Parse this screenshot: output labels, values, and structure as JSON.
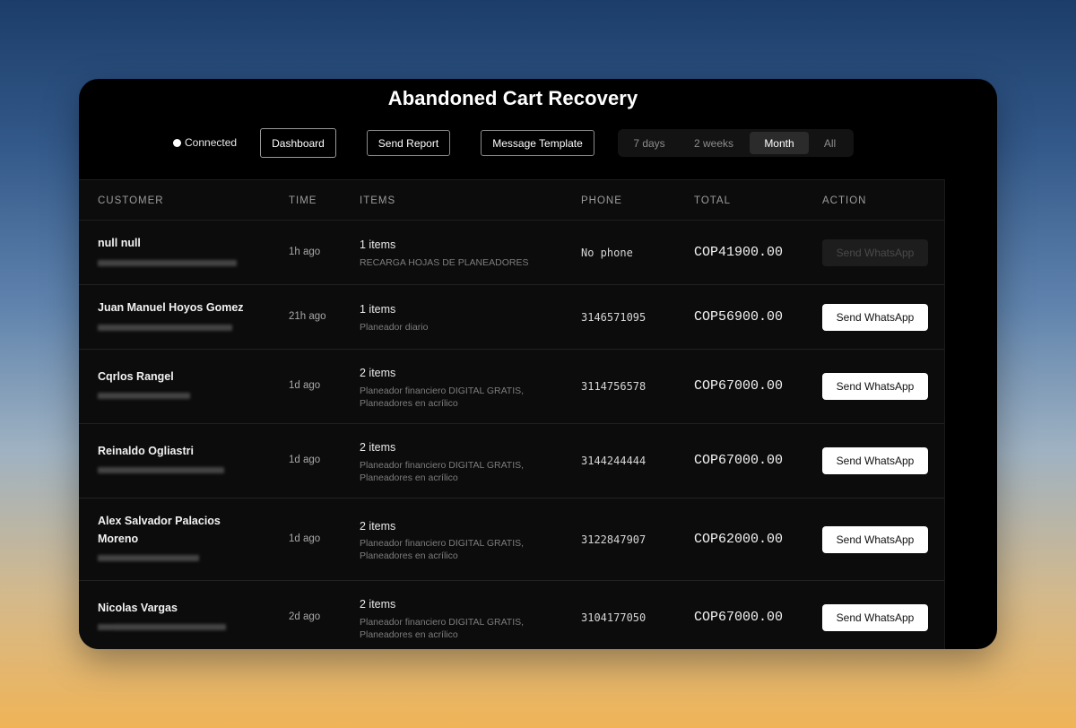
{
  "app": {
    "title": "Abandoned Cart Recovery"
  },
  "header": {
    "status_label": "Connected",
    "buttons": {
      "dashboard": "Dashboard",
      "send_report": "Send Report",
      "message_template": "Message Template"
    },
    "range_options": [
      "7 days",
      "2 weeks",
      "Month",
      "All"
    ],
    "range_selected": "Month"
  },
  "table": {
    "columns": [
      "CUSTOMER",
      "TIME",
      "ITEMS",
      "PHONE",
      "TOTAL",
      "ACTION"
    ],
    "rows": [
      {
        "name": "null null",
        "time": "1h ago",
        "items_count": "1 items",
        "items_desc": "RECARGA HOJAS DE PLANEADORES",
        "phone": "No phone",
        "total": "COP41900.00",
        "action": "Send WhatsApp",
        "action_enabled": false
      },
      {
        "name": "Juan Manuel Hoyos Gomez",
        "time": "21h ago",
        "items_count": "1 items",
        "items_desc": "Planeador diario",
        "phone": "3146571095",
        "total": "COP56900.00",
        "action": "Send WhatsApp",
        "action_enabled": true
      },
      {
        "name": "Cqrlos Rangel",
        "time": "1d ago",
        "items_count": "2 items",
        "items_desc": "Planeador financiero DIGITAL GRATIS, Planeadores en acrílico",
        "phone": "3114756578",
        "total": "COP67000.00",
        "action": "Send WhatsApp",
        "action_enabled": true
      },
      {
        "name": "Reinaldo Ogliastri",
        "time": "1d ago",
        "items_count": "2 items",
        "items_desc": "Planeador financiero DIGITAL GRATIS, Planeadores en acrílico",
        "phone": "3144244444",
        "total": "COP67000.00",
        "action": "Send WhatsApp",
        "action_enabled": true
      },
      {
        "name": "Alex Salvador Palacios Moreno",
        "time": "1d ago",
        "items_count": "2 items",
        "items_desc": "Planeador financiero DIGITAL GRATIS, Planeadores en acrílico",
        "phone": "3122847907",
        "total": "COP62000.00",
        "action": "Send WhatsApp",
        "action_enabled": true
      },
      {
        "name": "Nicolas Vargas",
        "time": "2d ago",
        "items_count": "2 items",
        "items_desc": "Planeador financiero DIGITAL GRATIS, Planeadores en acrílico",
        "phone": "3104177050",
        "total": "COP67000.00",
        "action": "Send WhatsApp",
        "action_enabled": true
      }
    ]
  },
  "colors": {
    "window_bg": "#000000",
    "table_bg": "#0c0c0c",
    "button_primary_bg": "#ffffff",
    "button_disabled_bg": "#1d1d1d"
  }
}
